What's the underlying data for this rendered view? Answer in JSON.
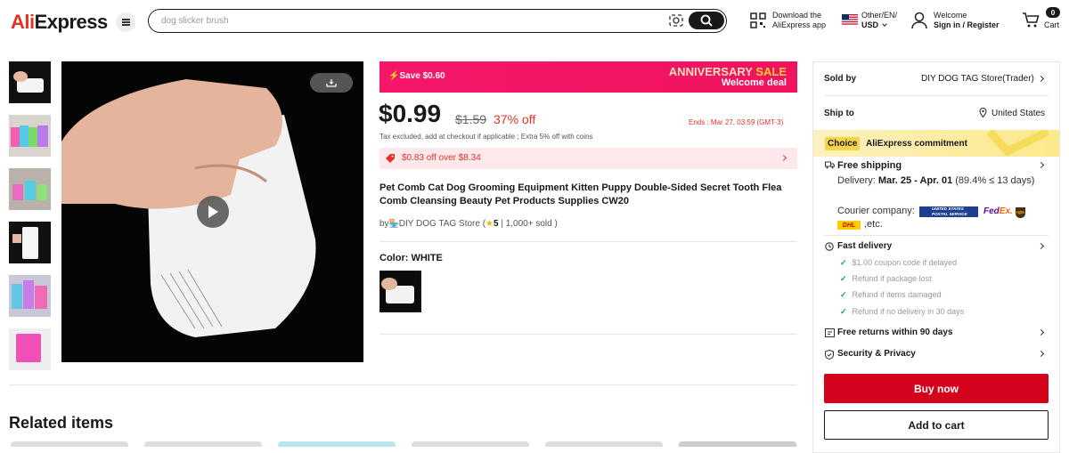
{
  "header": {
    "logo_prefix": "Ali",
    "logo_suffix": "Express",
    "search_value": "dog slicker brush",
    "download_line1": "Download the",
    "download_line2": "AliExpress app",
    "locale_line1": "Other/EN/",
    "locale_line2": "USD",
    "welcome_line1": "Welcome",
    "welcome_line2": "Sign in / Register",
    "cart_count": "0",
    "cart_label": "Cart"
  },
  "deal": {
    "save": "Save $0.60",
    "anniversary_a": "ANNIVERSARY ",
    "anniversary_b": "SALE",
    "welcome": "Welcome deal",
    "price": "$0.99",
    "old_price": "$1.59",
    "discount": "37% off",
    "ends": "Ends : Mar 27, 03:59 (GMT-3)",
    "tax": "Tax excluded, add at checkout if applicable ; Extra 5% off with coins",
    "coupon": "$0.83 off over $8.34"
  },
  "product": {
    "title": "Pet Comb Cat Dog Grooming Equipment Kitten Puppy Double-Sided Secret Tooth Flea Comb Cleansing Beauty Pet Products Supplies CW20",
    "store_prefix": "by",
    "store_name": "DIY DOG TAG Store (",
    "rating": "5",
    "sold": " | 1,000+ sold )",
    "color_label": "Color: WHITE"
  },
  "related_title": "Related items",
  "panel": {
    "sold_by_label": "Sold by",
    "sold_by_value": "DIY DOG TAG Store(Trader)",
    "ship_to_label": "Ship to",
    "ship_to_value": "United States",
    "choice_badge": "Choice",
    "commitment": "AliExpress commitment",
    "free_shipping": "Free shipping",
    "delivery_prefix": "Delivery: ",
    "delivery_dates": "Mar. 25 - Apr. 01",
    "delivery_suffix": " (89.4% ≤ 13 days)",
    "courier_label": "Courier company:",
    "courier_usps": "UNITED STATES POSTAL SERVICE",
    "courier_fedex_a": "Fed",
    "courier_fedex_b": "Ex.",
    "courier_ups": "ups",
    "courier_dhl": "DHL",
    "courier_etc": ",etc.",
    "fast_delivery": "Fast delivery",
    "guarantees": [
      "$1.00 coupon code if delayed",
      "Refund if package lost",
      "Refund if items damaged",
      "Refund if no delivery in 30 days"
    ],
    "free_returns": "Free returns within 90 days",
    "security": "Security & Privacy",
    "buy_now": "Buy now",
    "add_to_cart": "Add to cart"
  },
  "colors": {
    "brand_red": "#e43225",
    "banner_pink": "#f5166a",
    "buy_red": "#d3031c",
    "choice_yellow": "#fbe98a"
  }
}
